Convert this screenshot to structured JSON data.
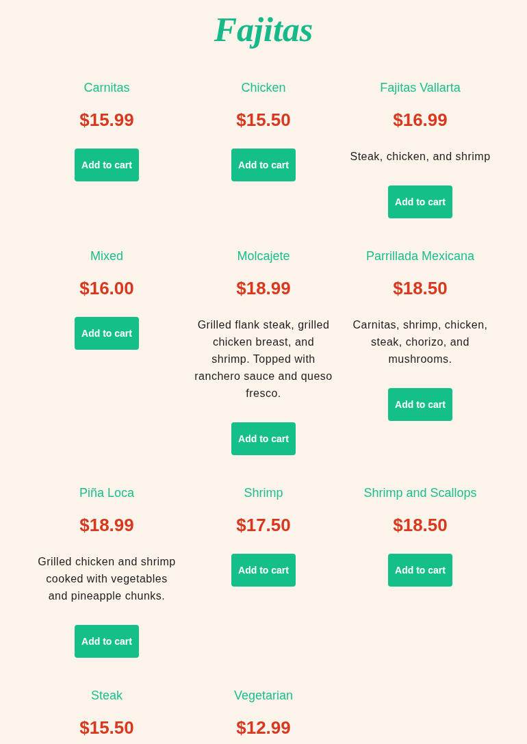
{
  "title": "Fajitas",
  "items": [
    {
      "name": "Carnitas",
      "price": "$15.99",
      "button": "Add to cart"
    },
    {
      "name": "Chicken",
      "price": "$15.50",
      "button": "Add to cart"
    },
    {
      "name": "Fajitas Vallarta",
      "price": "$16.99",
      "description": "Steak, chicken, and shrimp",
      "button": "Add to cart"
    },
    {
      "name": "Mixed",
      "price": "$16.00",
      "button": "Add to cart"
    },
    {
      "name": "Molcajete",
      "price": "$18.99",
      "description": "Grilled flank steak, grilled chicken breast, and shrimp. Topped with ranchero sauce and queso fresco.",
      "button": "Add to cart"
    },
    {
      "name": "Parrillada Mexicana",
      "price": "$18.50",
      "description": "Carnitas, shrimp, chicken, steak, chorizo, and mushrooms.",
      "button": "Add to cart"
    },
    {
      "name": "Piña Loca",
      "price": "$18.99",
      "description": "Grilled chicken and shrimp cooked with vegetables and pineapple chunks.",
      "button": "Add to cart"
    },
    {
      "name": "Shrimp",
      "price": "$17.50",
      "button": "Add to cart"
    },
    {
      "name": "Shrimp and Scallops",
      "price": "$18.50",
      "button": "Add to cart"
    },
    {
      "name": "Steak",
      "price": "$15.50"
    },
    {
      "name": "Vegetarian",
      "price": "$12.99"
    }
  ]
}
